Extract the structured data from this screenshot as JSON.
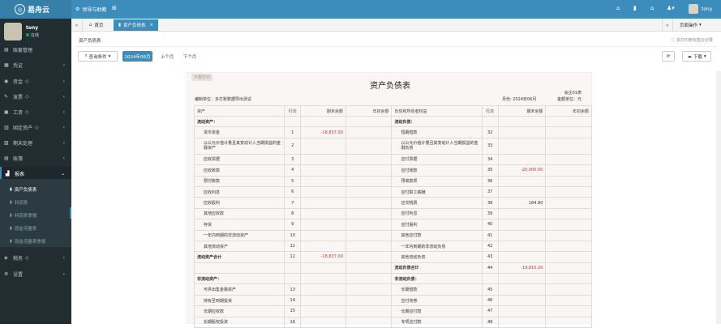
{
  "app": {
    "logo_text": "易舟云",
    "link": "领导与助教",
    "user": "tony",
    "status": "在线"
  },
  "sidebar": {
    "items": [
      {
        "icon": "inbox-icon",
        "label": "账套管理",
        "arrow": ""
      },
      {
        "icon": "voucher-icon",
        "label": "凭证",
        "arrow": "‹"
      },
      {
        "icon": "money-icon",
        "label": "资金",
        "arrow": "‹"
      },
      {
        "icon": "invoice-icon",
        "label": "发票",
        "arrow": "‹"
      },
      {
        "icon": "salary-icon",
        "label": "工资",
        "arrow": "‹"
      },
      {
        "icon": "asset-icon",
        "label": "固定资产",
        "arrow": "‹"
      },
      {
        "icon": "period-icon",
        "label": "期末处理",
        "arrow": "‹"
      },
      {
        "icon": "ledger-icon",
        "label": "账簿",
        "arrow": "‹"
      },
      {
        "icon": "report-icon",
        "label": "报表",
        "arrow": "⌄"
      },
      {
        "icon": "tax-icon",
        "label": "税务",
        "arrow": "‹"
      },
      {
        "icon": "settings-icon",
        "label": "设置",
        "arrow": "‹"
      }
    ],
    "report_sub": [
      "资产负债表",
      "利润表",
      "利润表季报",
      "现金流量表",
      "现金流量表季报"
    ]
  },
  "tabs": {
    "home": "首页",
    "active": "资产负债表",
    "ops": "页面操作"
  },
  "page": {
    "header": "资产负债表",
    "hint": "多打印账标签云记录",
    "filter": "查询条件",
    "period": "2024年06月",
    "prev": "上个月",
    "next": "下个月",
    "download": "下载"
  },
  "sheet": {
    "unsaved": "不要打印",
    "title": "资产负债表",
    "form_no": "会企01表",
    "unit_right": "金额单位：元",
    "company": "编制单位：多打账数据导出测试",
    "month": "月份: 2024年06月",
    "header": [
      "资产",
      "行次",
      "期末余额",
      "年初余额",
      "负债和所有者权益",
      "行次",
      "期末余额",
      "年初余额"
    ],
    "rows": [
      [
        "流动资产：",
        "",
        "",
        "",
        "流动负债：",
        "",
        "",
        ""
      ],
      [
        "货币资金",
        "1",
        "-18,837.00",
        "",
        "短期借款",
        "32",
        "",
        ""
      ],
      [
        "以公允价值计量且其变动计入当期损益的金融资产",
        "2",
        "",
        "",
        "以公允价值计量且其变动计入当期损益的金融负债",
        "33",
        "",
        ""
      ],
      [
        "应收票据",
        "3",
        "",
        "",
        "应付票据",
        "34",
        "",
        ""
      ],
      [
        "应收账款",
        "4",
        "",
        "",
        "应付账款",
        "35",
        "-20,000.00",
        ""
      ],
      [
        "预付账款",
        "5",
        "",
        "",
        "预收款项",
        "36",
        "",
        ""
      ],
      [
        "应收利息",
        "6",
        "",
        "",
        "应付职工薪酬",
        "37",
        "",
        ""
      ],
      [
        "应收股利",
        "7",
        "",
        "",
        "应交税费",
        "38",
        "184.80",
        ""
      ],
      [
        "其他应收款",
        "8",
        "",
        "",
        "应付利息",
        "39",
        "",
        ""
      ],
      [
        "存货",
        "9",
        "",
        "",
        "应付股利",
        "40",
        "",
        ""
      ],
      [
        "一年内到期的非流动资产",
        "10",
        "",
        "",
        "其他应付款",
        "41",
        "",
        ""
      ],
      [
        "其他流动资产",
        "11",
        "",
        "",
        "一年内到期的非流动负债",
        "42",
        "",
        ""
      ],
      [
        "流动资产合计",
        "12",
        "-18,837.00",
        "",
        "其他流动负债",
        "43",
        "",
        ""
      ],
      [
        "",
        "",
        "",
        "",
        "流动负债合计",
        "44",
        "-19,815.20",
        ""
      ],
      [
        "非流动资产：",
        "",
        "",
        "",
        "非流动负债：",
        "",
        "",
        ""
      ],
      [
        "可供出售金融资产",
        "13",
        "",
        "",
        "长期借款",
        "45",
        "",
        ""
      ],
      [
        "持有至到期投资",
        "14",
        "",
        "",
        "应付债券",
        "46",
        "",
        ""
      ],
      [
        "长期应收款",
        "15",
        "",
        "",
        "长期应付款",
        "47",
        "",
        ""
      ],
      [
        "长期股权投资",
        "16",
        "",
        "",
        "专项应付款",
        "48",
        "",
        ""
      ]
    ]
  }
}
